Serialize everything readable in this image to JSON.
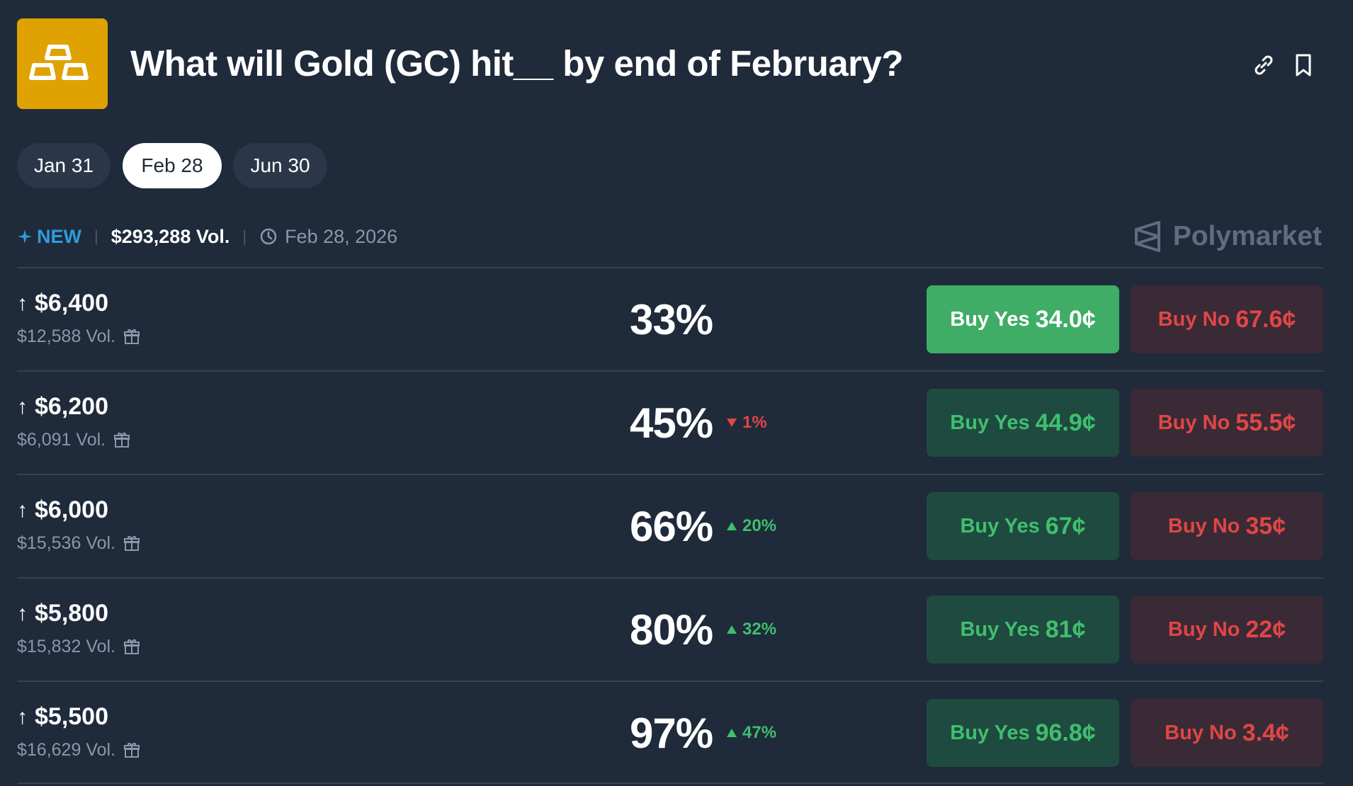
{
  "header": {
    "title": "What will Gold (GC) hit__ by end of February?",
    "logo_icon": "gold-bars-icon",
    "link_icon": "link-icon",
    "bookmark_icon": "bookmark-icon"
  },
  "tabs": [
    {
      "label": "Jan 31",
      "active": false
    },
    {
      "label": "Feb 28",
      "active": true
    },
    {
      "label": "Jun 30",
      "active": false
    }
  ],
  "meta": {
    "new_label": "NEW",
    "volume": "$293,288 Vol.",
    "end_date": "Feb 28, 2026"
  },
  "brand": {
    "name": "Polymarket"
  },
  "colors": {
    "background": "#1f2a3a",
    "gold": "#e0a200",
    "yes_green": "#3fbf6e",
    "no_red": "#e04646",
    "new_blue": "#2d9cdb"
  },
  "markets": [
    {
      "strike": "$6,400",
      "volume": "$12,588 Vol.",
      "chance": "33%",
      "change": "",
      "direction": "",
      "yes_label": "Buy Yes",
      "yes_price": "34.0¢",
      "no_label": "Buy No",
      "no_price": "67.6¢",
      "yes_primary": true
    },
    {
      "strike": "$6,200",
      "volume": "$6,091 Vol.",
      "chance": "45%",
      "change": "1%",
      "direction": "down",
      "yes_label": "Buy Yes",
      "yes_price": "44.9¢",
      "no_label": "Buy No",
      "no_price": "55.5¢",
      "yes_primary": false
    },
    {
      "strike": "$6,000",
      "volume": "$15,536 Vol.",
      "chance": "66%",
      "change": "20%",
      "direction": "up",
      "yes_label": "Buy Yes",
      "yes_price": "67¢",
      "no_label": "Buy No",
      "no_price": "35¢",
      "yes_primary": false
    },
    {
      "strike": "$5,800",
      "volume": "$15,832 Vol.",
      "chance": "80%",
      "change": "32%",
      "direction": "up",
      "yes_label": "Buy Yes",
      "yes_price": "81¢",
      "no_label": "Buy No",
      "no_price": "22¢",
      "yes_primary": false
    },
    {
      "strike": "$5,500",
      "volume": "$16,629 Vol.",
      "chance": "97%",
      "change": "47%",
      "direction": "up",
      "yes_label": "Buy Yes",
      "yes_price": "96.8¢",
      "no_label": "Buy No",
      "no_price": "3.4¢",
      "yes_primary": false
    }
  ]
}
